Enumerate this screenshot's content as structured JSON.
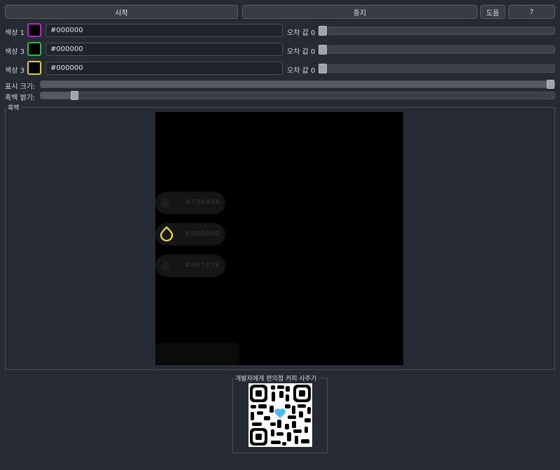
{
  "toolbar": {
    "start_label": "시작",
    "stop_label": "중지",
    "help_label": "도움",
    "about_label": "?"
  },
  "colors": [
    {
      "label": "색상 1",
      "hex": "#000000",
      "tolerance_label": "오차 값",
      "tolerance_value": "0",
      "border": "#c020d0"
    },
    {
      "label": "색상 3",
      "hex": "#000000",
      "tolerance_label": "오차 값",
      "tolerance_value": "0",
      "border": "#20c030"
    },
    {
      "label": "색상 3",
      "hex": "#000000",
      "tolerance_label": "오차 값",
      "tolerance_value": "0",
      "border": "#e0d020"
    }
  ],
  "display": {
    "size_label": "표시 크기:",
    "brightness_label": "흑백 밝기:",
    "size_level": 1.0,
    "brightness_level": 0.07
  },
  "preview": {
    "title": "흑백",
    "items": [
      {
        "text": "#73685A"
      },
      {
        "text": "#000000"
      },
      {
        "text": "#867C7E"
      }
    ]
  },
  "donate": {
    "title": "개발자에게 편의점 커피 사주기"
  }
}
